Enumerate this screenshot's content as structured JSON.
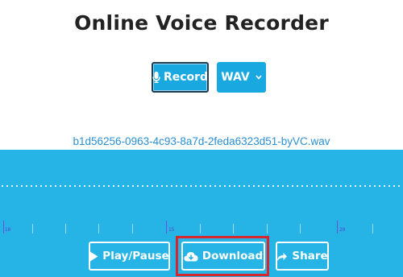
{
  "app": {
    "title": "Online Voice Recorder"
  },
  "controls": {
    "record_label": "Record",
    "format_label": "WAV"
  },
  "file": {
    "name": "b1d56256-0963-4c93-8a7d-2feda6323d51-byVC.wav"
  },
  "timeline": {
    "labels": [
      "10",
      "15",
      "20"
    ]
  },
  "actions": {
    "play_pause_label": "Play/Pause",
    "download_label": "Download",
    "share_label": "Share"
  },
  "icons": [
    "microphone-icon",
    "chevron-down-icon",
    "play-icon",
    "cloud-download-icon",
    "share-icon"
  ],
  "colors": {
    "accent": "#1aa8e0",
    "waveform_background": "#26b3e6",
    "title_text": "#222222",
    "filename_link": "#2a8fd3",
    "highlight_border": "#d7262e"
  }
}
